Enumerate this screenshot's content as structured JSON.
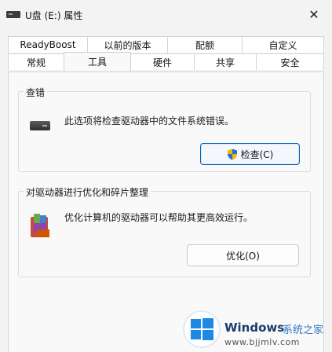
{
  "window": {
    "title": "U盘 (E:) 属性",
    "close_glyph": "✕"
  },
  "tabs": {
    "row_back": [
      "ReadyBoost",
      "以前的版本",
      "配额",
      "自定义"
    ],
    "row_front": [
      "常规",
      "工具",
      "硬件",
      "共享",
      "安全"
    ],
    "active": "工具"
  },
  "error_check": {
    "title": "查错",
    "description": "此选项将检查驱动器中的文件系统错误。",
    "button_label": "检查(C)"
  },
  "optimize": {
    "title": "对驱动器进行优化和碎片整理",
    "description": "优化计算机的驱动器可以帮助其更高效运行。",
    "button_label": "优化(O)"
  },
  "watermark": {
    "brand": "Windows",
    "site_name": "系统之家",
    "url": "www.bjjmlv.com"
  },
  "icons": {
    "title": "drive-icon",
    "error_check": "drive-icon",
    "check_button": "shield-icon",
    "optimize": "defrag-icon",
    "watermark": "windows-logo-icon"
  },
  "colors": {
    "accent": "#005fb8",
    "background": "#f3f3f3",
    "panel": "#f9f9f9"
  }
}
